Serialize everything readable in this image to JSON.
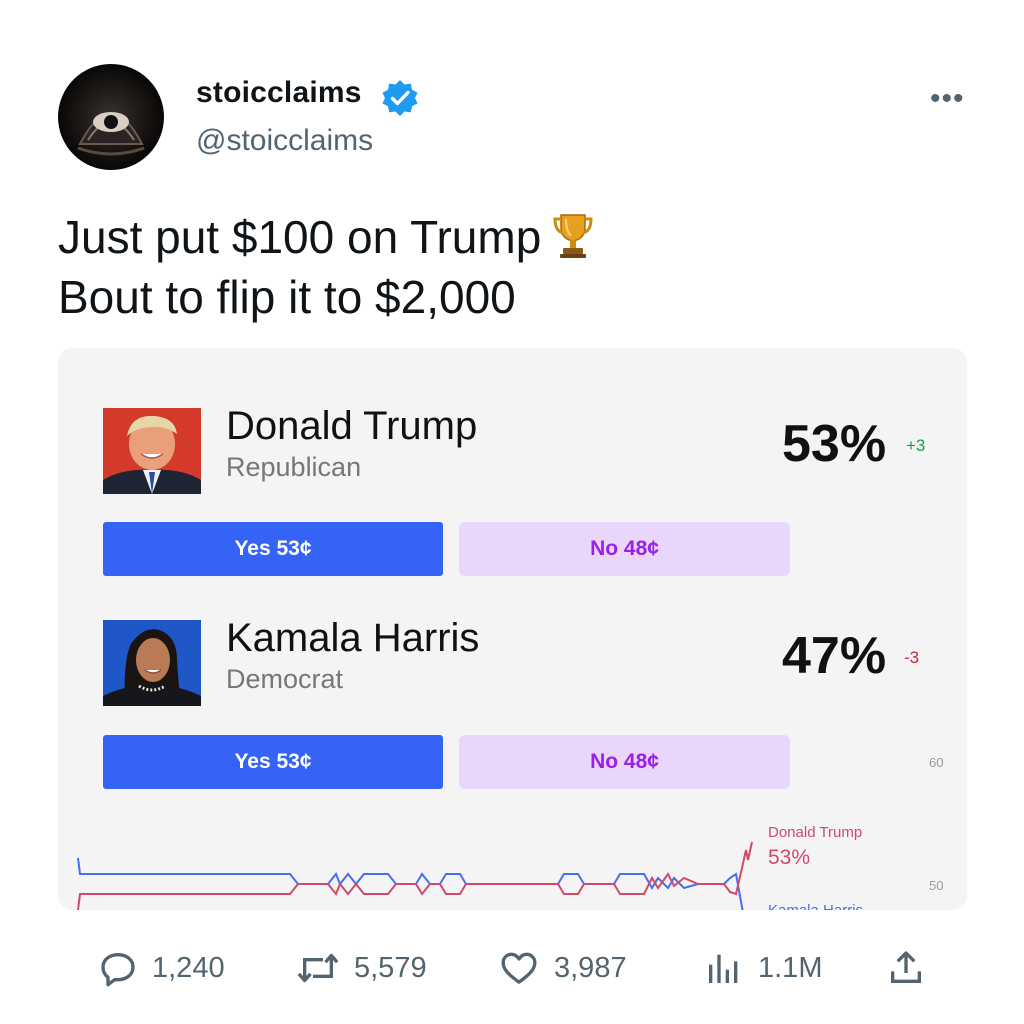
{
  "tweet": {
    "display_name": "stoicclaims",
    "handle": "@stoicclaims",
    "text_line1": "Just put $100 on Trump",
    "text_line2": "Bout to flip it to $2,000",
    "more_label": "•••"
  },
  "market": {
    "candidates": [
      {
        "name": "Donald Trump",
        "party": "Republican",
        "pct": "53%",
        "delta": "+3",
        "yes": "Yes 53¢",
        "no": "No 48¢"
      },
      {
        "name": "Kamala Harris",
        "party": "Democrat",
        "pct": "47%",
        "delta": "-3",
        "yes": "Yes 53¢",
        "no": "No 48¢"
      }
    ],
    "chart": {
      "y_ticks": [
        "60",
        "50"
      ],
      "legend_trump_name": "Donald Trump",
      "legend_trump_pct": "53%",
      "legend_harris_name": "Kamala Harris"
    }
  },
  "actions": {
    "replies": "1,240",
    "retweets": "5,579",
    "likes": "3,987",
    "views": "1.1M"
  },
  "colors": {
    "accent": "#1d9bf0",
    "yes": "#3463f5",
    "no_bg": "#ead5fb",
    "no_text": "#9b1fe8",
    "trump_line": "#cf4a6b",
    "harris_line": "#4a6cf0"
  }
}
